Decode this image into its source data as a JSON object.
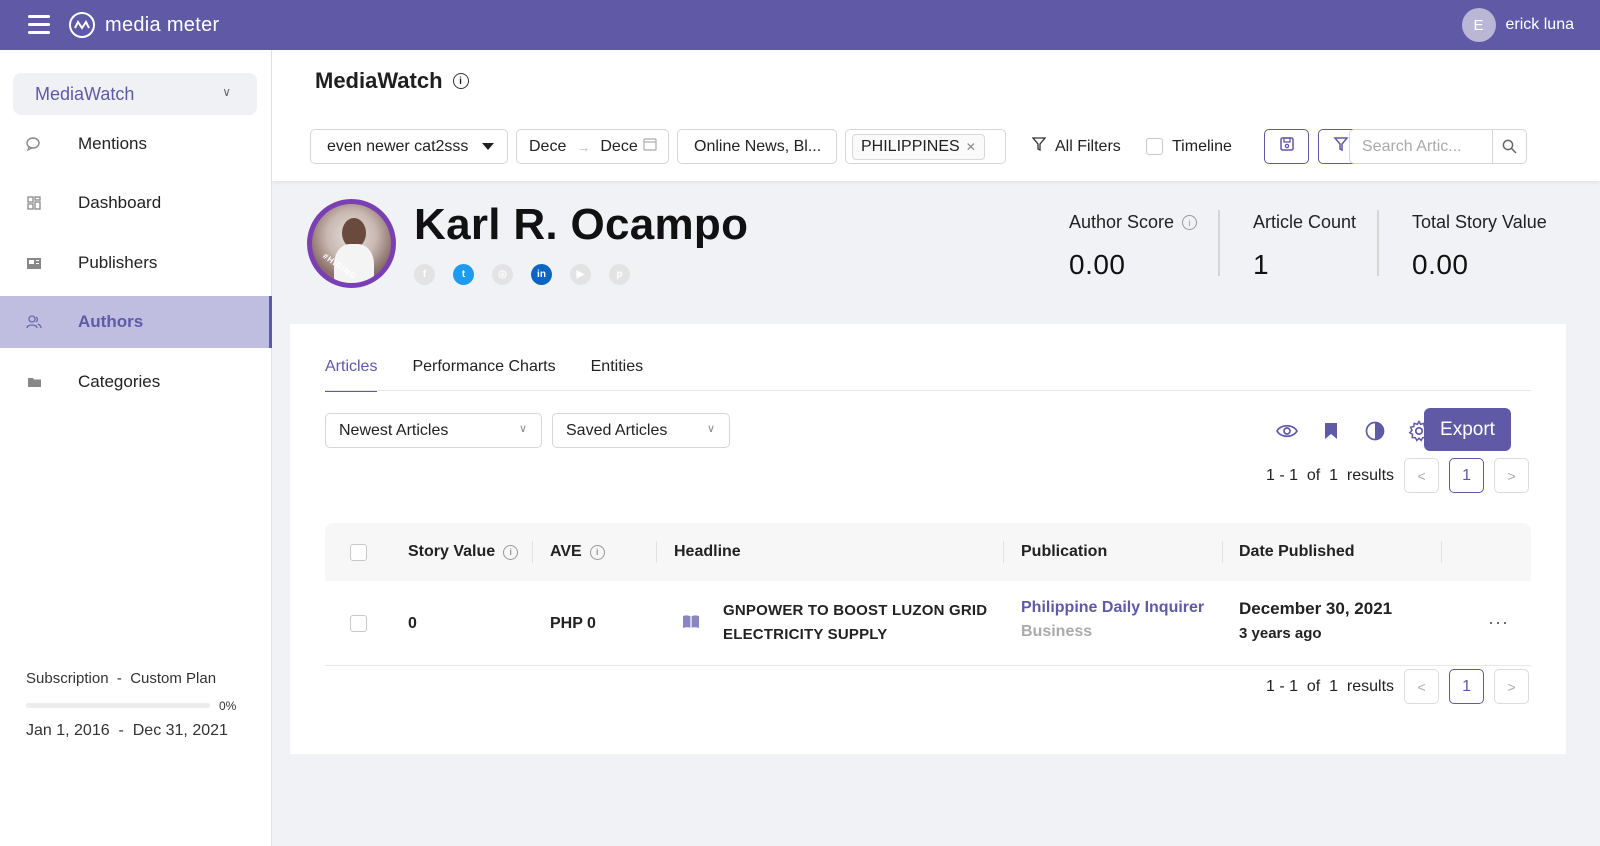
{
  "topbar": {
    "brand": "media meter",
    "user_initial": "E",
    "user_name": "erick luna"
  },
  "sidebar": {
    "workspace": "MediaWatch",
    "items": [
      {
        "label": "Mentions",
        "icon": "chat-bubbles-icon"
      },
      {
        "label": "Dashboard",
        "icon": "dashboard-grid-icon"
      },
      {
        "label": "Publishers",
        "icon": "newspaper-icon"
      },
      {
        "label": "Authors",
        "icon": "people-icon",
        "active": true
      },
      {
        "label": "Categories",
        "icon": "folder-icon"
      }
    ],
    "subscription_label": "Subscription  -  Custom Plan",
    "subscription_percent": "0%",
    "subscription_progress": 0,
    "subscription_range": "Jan 1, 2016  -  Dec 31, 2021"
  },
  "header": {
    "title": "MediaWatch",
    "filters": {
      "category": "even newer cat2sss",
      "date_start": "Dece",
      "date_end": "Dece",
      "media_types": "Online News, Bl...",
      "country_tag": "PHILIPPINES",
      "all_filters": "All Filters",
      "timeline": "Timeline",
      "search_placeholder": "Search Artic..."
    }
  },
  "author": {
    "name": "Karl R. Ocampo",
    "photo_badge": "#HIRING",
    "socials": [
      "f",
      "t",
      "◎",
      "in",
      "▶",
      "p"
    ],
    "metrics": [
      {
        "label": "Author Score",
        "value": "0.00"
      },
      {
        "label": "Article Count",
        "value": "1"
      },
      {
        "label": "Total Story Value",
        "value": "0.00"
      }
    ]
  },
  "content": {
    "tabs": [
      "Articles",
      "Performance Charts",
      "Entities"
    ],
    "sort_select": "Newest Articles",
    "saved_select": "Saved Articles",
    "export_label": "Export",
    "results_text": "1 - 1  of  1  results",
    "current_page": "1",
    "columns": [
      "Story Value",
      "AVE",
      "Headline",
      "Publication",
      "Date Published"
    ],
    "rows": [
      {
        "story_value": "0",
        "ave": "PHP 0",
        "headline_line1": "GNPOWER TO BOOST LUZON GRID",
        "headline_line2": "ELECTRICITY SUPPLY",
        "publication": "Philippine Daily Inquirer",
        "section": "Business",
        "date": "December 30, 2021",
        "relative": "3 years ago"
      }
    ]
  },
  "colors": {
    "brand": "#5f59a6",
    "active_nav": "#bfbde0"
  }
}
